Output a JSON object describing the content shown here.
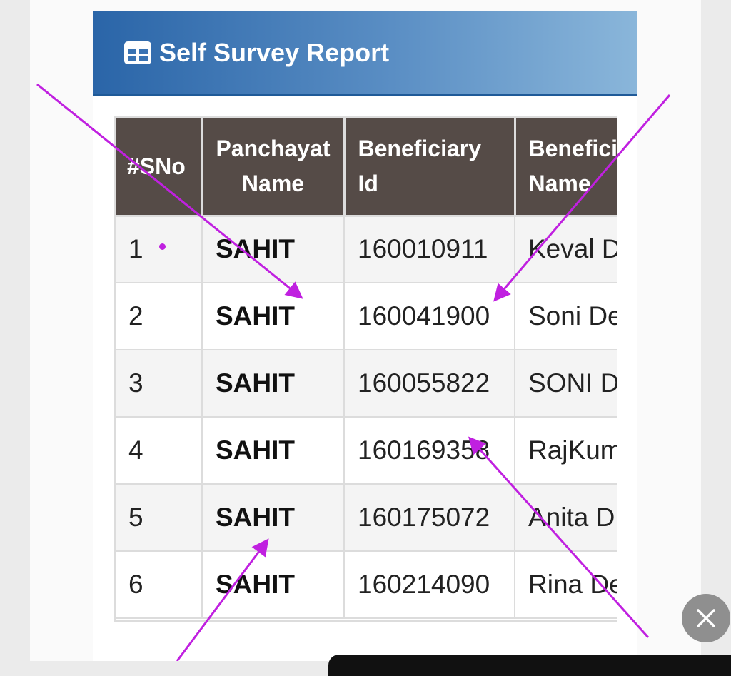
{
  "report": {
    "title": "Self Survey Report",
    "header_icon": "table-icon"
  },
  "table": {
    "headers": {
      "sno": "#SNo",
      "panchayat": "Panchayat Name",
      "beneficiary_id": "Beneficiary Id",
      "beneficiary_name": "Benefici Name"
    },
    "rows": [
      {
        "sno": "1",
        "panchayat": "SAHIT",
        "beneficiary_id": "160010911",
        "beneficiary_name": "Keval D"
      },
      {
        "sno": "2",
        "panchayat": "SAHIT",
        "beneficiary_id": "160041900",
        "beneficiary_name": "Soni De"
      },
      {
        "sno": "3",
        "panchayat": "SAHIT",
        "beneficiary_id": "160055822",
        "beneficiary_name": "SONI D"
      },
      {
        "sno": "4",
        "panchayat": "SAHIT",
        "beneficiary_id": "160169358",
        "beneficiary_name": "RajKum"
      },
      {
        "sno": "5",
        "panchayat": "SAHIT",
        "beneficiary_id": "160175072",
        "beneficiary_name": "Anita D"
      },
      {
        "sno": "6",
        "panchayat": "SAHIT",
        "beneficiary_id": "160214090",
        "beneficiary_name": "Rina De"
      }
    ]
  },
  "close_button": {
    "icon": "close-icon"
  },
  "colors": {
    "header_gradient_start": "#2a65a8",
    "header_gradient_end": "#8ab6da",
    "table_header_bg": "#554b47",
    "annotation_arrow": "#c020e0"
  }
}
